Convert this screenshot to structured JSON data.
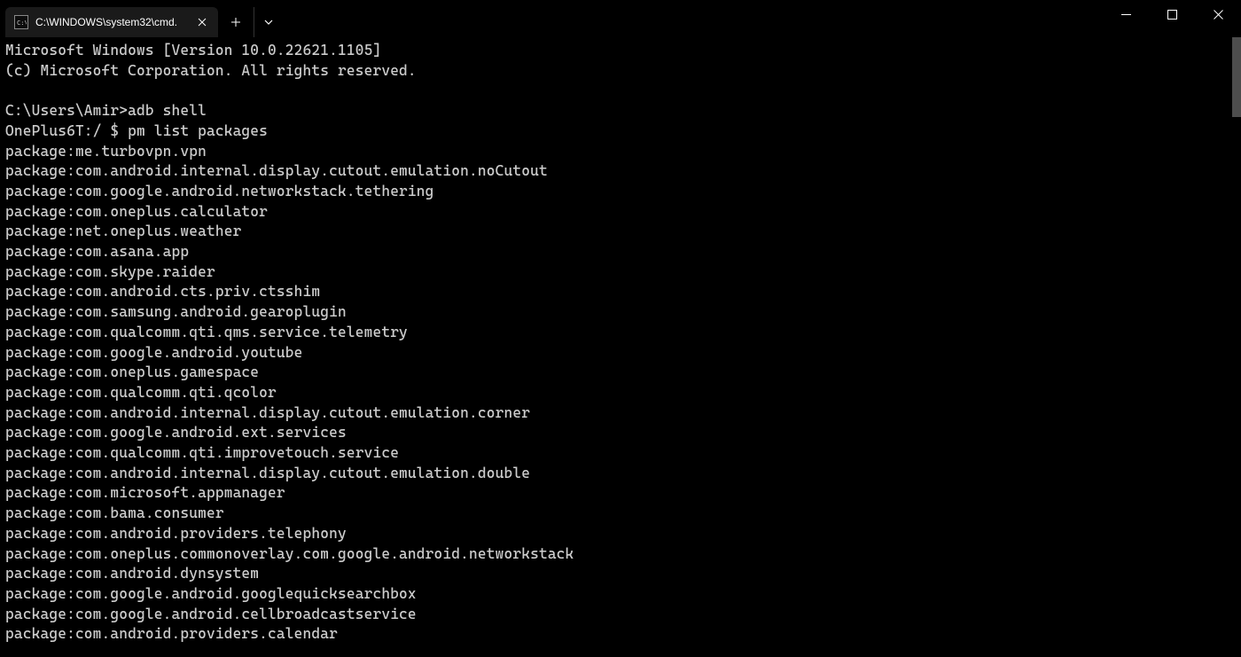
{
  "tab": {
    "title": "C:\\WINDOWS\\system32\\cmd."
  },
  "terminal": {
    "header1": "Microsoft Windows [Version 10.0.22621.1105]",
    "header2": "(c) Microsoft Corporation. All rights reserved.",
    "blank1": "",
    "prompt1": "C:\\Users\\Amir>adb shell",
    "prompt2": "OnePlus6T:/ $ pm list packages",
    "packages": [
      "package:me.turbovpn.vpn",
      "package:com.android.internal.display.cutout.emulation.noCutout",
      "package:com.google.android.networkstack.tethering",
      "package:com.oneplus.calculator",
      "package:net.oneplus.weather",
      "package:com.asana.app",
      "package:com.skype.raider",
      "package:com.android.cts.priv.ctsshim",
      "package:com.samsung.android.gearoplugin",
      "package:com.qualcomm.qti.qms.service.telemetry",
      "package:com.google.android.youtube",
      "package:com.oneplus.gamespace",
      "package:com.qualcomm.qti.qcolor",
      "package:com.android.internal.display.cutout.emulation.corner",
      "package:com.google.android.ext.services",
      "package:com.qualcomm.qti.improvetouch.service",
      "package:com.android.internal.display.cutout.emulation.double",
      "package:com.microsoft.appmanager",
      "package:com.bama.consumer",
      "package:com.android.providers.telephony",
      "package:com.oneplus.commonoverlay.com.google.android.networkstack",
      "package:com.android.dynsystem",
      "package:com.google.android.googlequicksearchbox",
      "package:com.google.android.cellbroadcastservice",
      "package:com.android.providers.calendar"
    ]
  }
}
